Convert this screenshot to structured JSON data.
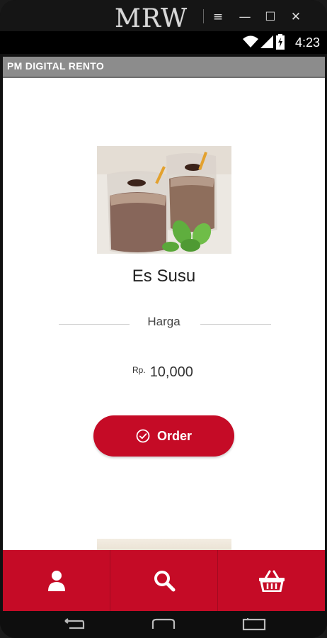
{
  "window": {
    "brand": "MRW",
    "controls": [
      "≡",
      "—",
      "☐",
      "✕"
    ]
  },
  "status_bar": {
    "time": "4:23"
  },
  "action_bar": {
    "title": "PM DIGITAL RENTO"
  },
  "product": {
    "name": "Es Susu",
    "price_label": "Harga",
    "currency": "Rp.",
    "price": "10,000",
    "order_label": "Order"
  },
  "bottom_nav": [
    {
      "icon": "user-icon"
    },
    {
      "icon": "search-icon"
    },
    {
      "icon": "basket-icon"
    }
  ],
  "system_nav": [
    "back-icon",
    "home-icon",
    "recents-icon"
  ],
  "colors": {
    "accent": "#c50b26",
    "action_bar": "#8c8c8c"
  }
}
